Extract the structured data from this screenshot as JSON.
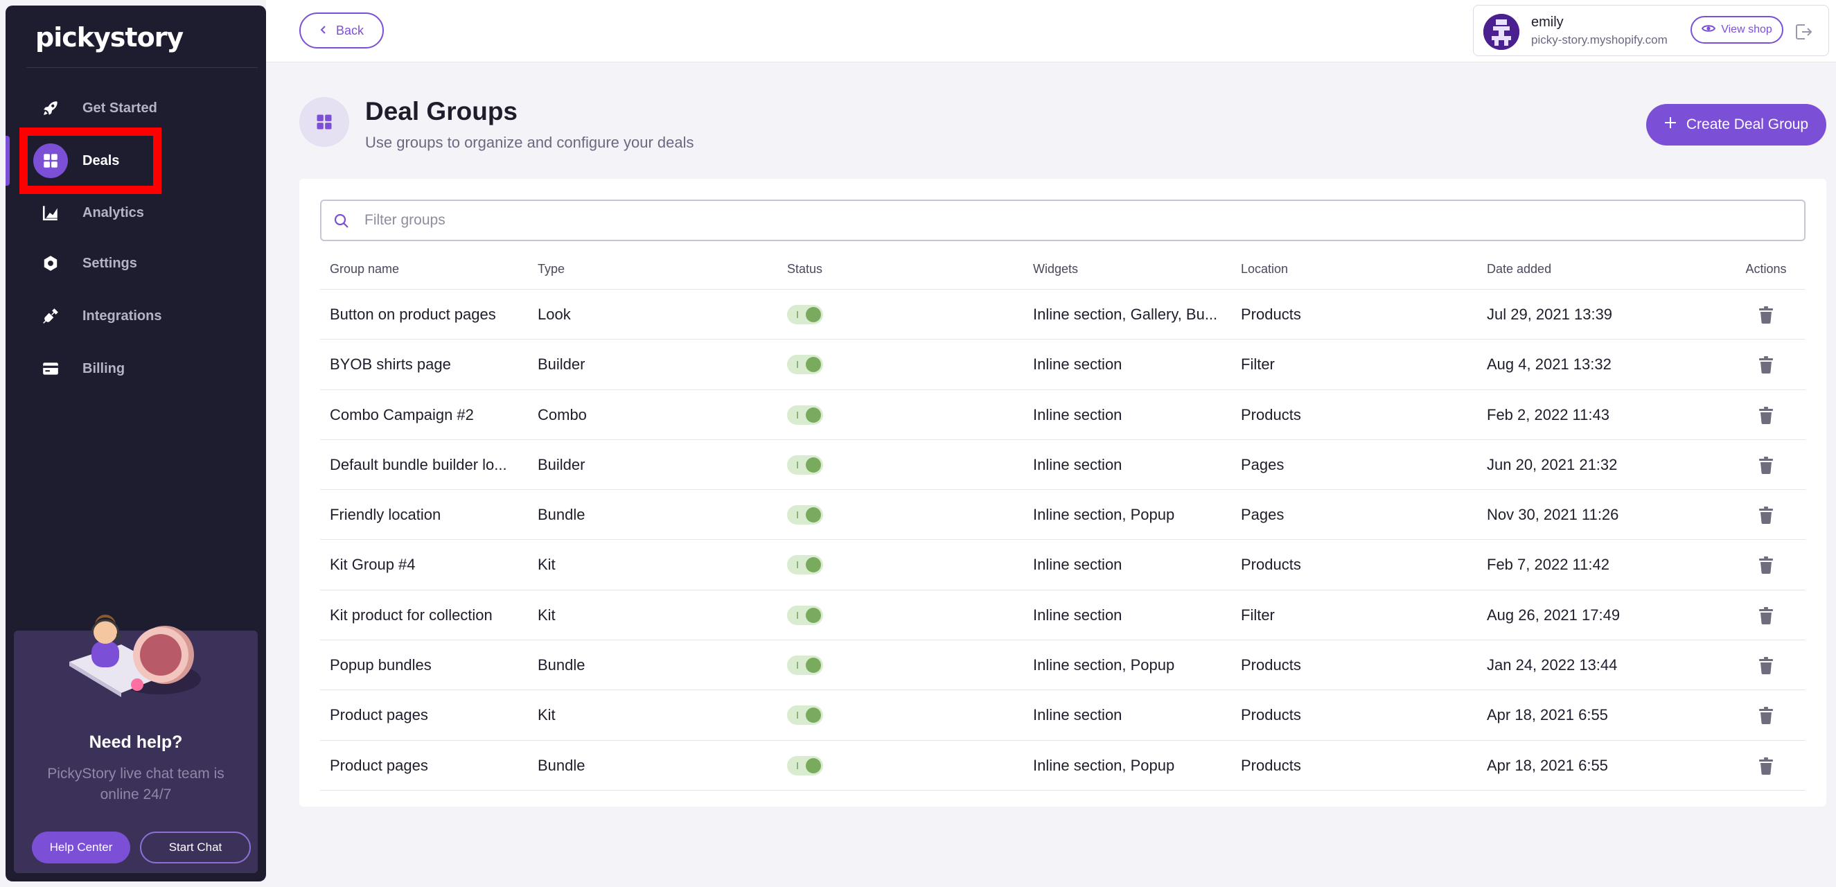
{
  "app": {
    "logo_text": "pickystory"
  },
  "sidebar": {
    "items": [
      {
        "label": "Get Started",
        "icon": "rocket-icon"
      },
      {
        "label": "Deals",
        "icon": "grid-icon",
        "active": true
      },
      {
        "label": "Analytics",
        "icon": "chart-icon"
      },
      {
        "label": "Settings",
        "icon": "gear-icon"
      },
      {
        "label": "Integrations",
        "icon": "plug-icon"
      },
      {
        "label": "Billing",
        "icon": "credit-card-icon"
      }
    ],
    "help": {
      "title": "Need help?",
      "text": "PickyStory live chat team is online 24/7",
      "help_center_label": "Help Center",
      "start_chat_label": "Start Chat"
    }
  },
  "topbar": {
    "back_label": "Back",
    "account": {
      "name": "emily",
      "domain": "picky-story.myshopify.com",
      "view_shop_label": "View shop"
    }
  },
  "page": {
    "title": "Deal Groups",
    "subtitle": "Use groups to organize and configure your deals",
    "create_label": "Create Deal Group"
  },
  "search": {
    "placeholder": "Filter groups",
    "value": ""
  },
  "table": {
    "headers": {
      "name": "Group name",
      "type": "Type",
      "status": "Status",
      "widgets": "Widgets",
      "location": "Location",
      "date": "Date added",
      "actions": "Actions"
    },
    "rows": [
      {
        "name": "Button on product pages",
        "type": "Look",
        "status": "on",
        "widgets": "Inline section, Gallery, Bu...",
        "location": "Products",
        "date": "Jul 29, 2021 13:39"
      },
      {
        "name": "BYOB shirts page",
        "type": "Builder",
        "status": "on",
        "widgets": "Inline section",
        "location": "Filter",
        "date": "Aug 4, 2021 13:32"
      },
      {
        "name": "Combo Campaign #2",
        "type": "Combo",
        "status": "on",
        "widgets": "Inline section",
        "location": "Products",
        "date": "Feb 2, 2022 11:43"
      },
      {
        "name": "Default bundle builder lo...",
        "type": "Builder",
        "status": "on",
        "widgets": "Inline section",
        "location": "Pages",
        "date": "Jun 20, 2021 21:32"
      },
      {
        "name": "Friendly location",
        "type": "Bundle",
        "status": "on",
        "widgets": "Inline section, Popup",
        "location": "Pages",
        "date": "Nov 30, 2021 11:26"
      },
      {
        "name": "Kit Group #4",
        "type": "Kit",
        "status": "on",
        "widgets": "Inline section",
        "location": "Products",
        "date": "Feb 7, 2022 11:42"
      },
      {
        "name": "Kit product for collection",
        "type": "Kit",
        "status": "on",
        "widgets": "Inline section",
        "location": "Filter",
        "date": "Aug 26, 2021 17:49"
      },
      {
        "name": "Popup bundles",
        "type": "Bundle",
        "status": "on",
        "widgets": "Inline section, Popup",
        "location": "Products",
        "date": "Jan 24, 2022 13:44"
      },
      {
        "name": "Product pages",
        "type": "Kit",
        "status": "on",
        "widgets": "Inline section",
        "location": "Products",
        "date": "Apr 18, 2021 6:55"
      },
      {
        "name": "Product pages",
        "type": "Bundle",
        "status": "on",
        "widgets": "Inline section, Popup",
        "location": "Products",
        "date": "Apr 18, 2021 6:55"
      }
    ]
  },
  "colors": {
    "accent": "#7b4fd6",
    "sidebar_bg": "#1e1d2f",
    "toggle_on": "#7aaa5d",
    "highlight": "#ff0000"
  }
}
